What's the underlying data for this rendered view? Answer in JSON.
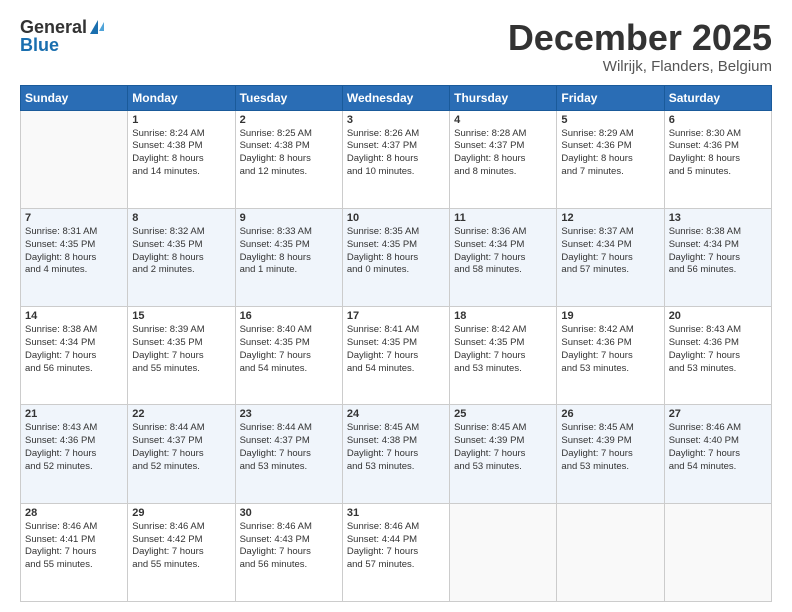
{
  "logo": {
    "general": "General",
    "blue": "Blue"
  },
  "title": {
    "month": "December 2025",
    "location": "Wilrijk, Flanders, Belgium"
  },
  "weekdays": [
    "Sunday",
    "Monday",
    "Tuesday",
    "Wednesday",
    "Thursday",
    "Friday",
    "Saturday"
  ],
  "weeks": [
    [
      {
        "day": "",
        "info": ""
      },
      {
        "day": "1",
        "info": "Sunrise: 8:24 AM\nSunset: 4:38 PM\nDaylight: 8 hours\nand 14 minutes."
      },
      {
        "day": "2",
        "info": "Sunrise: 8:25 AM\nSunset: 4:38 PM\nDaylight: 8 hours\nand 12 minutes."
      },
      {
        "day": "3",
        "info": "Sunrise: 8:26 AM\nSunset: 4:37 PM\nDaylight: 8 hours\nand 10 minutes."
      },
      {
        "day": "4",
        "info": "Sunrise: 8:28 AM\nSunset: 4:37 PM\nDaylight: 8 hours\nand 8 minutes."
      },
      {
        "day": "5",
        "info": "Sunrise: 8:29 AM\nSunset: 4:36 PM\nDaylight: 8 hours\nand 7 minutes."
      },
      {
        "day": "6",
        "info": "Sunrise: 8:30 AM\nSunset: 4:36 PM\nDaylight: 8 hours\nand 5 minutes."
      }
    ],
    [
      {
        "day": "7",
        "info": "Sunrise: 8:31 AM\nSunset: 4:35 PM\nDaylight: 8 hours\nand 4 minutes."
      },
      {
        "day": "8",
        "info": "Sunrise: 8:32 AM\nSunset: 4:35 PM\nDaylight: 8 hours\nand 2 minutes."
      },
      {
        "day": "9",
        "info": "Sunrise: 8:33 AM\nSunset: 4:35 PM\nDaylight: 8 hours\nand 1 minute."
      },
      {
        "day": "10",
        "info": "Sunrise: 8:35 AM\nSunset: 4:35 PM\nDaylight: 8 hours\nand 0 minutes."
      },
      {
        "day": "11",
        "info": "Sunrise: 8:36 AM\nSunset: 4:34 PM\nDaylight: 7 hours\nand 58 minutes."
      },
      {
        "day": "12",
        "info": "Sunrise: 8:37 AM\nSunset: 4:34 PM\nDaylight: 7 hours\nand 57 minutes."
      },
      {
        "day": "13",
        "info": "Sunrise: 8:38 AM\nSunset: 4:34 PM\nDaylight: 7 hours\nand 56 minutes."
      }
    ],
    [
      {
        "day": "14",
        "info": "Sunrise: 8:38 AM\nSunset: 4:34 PM\nDaylight: 7 hours\nand 56 minutes."
      },
      {
        "day": "15",
        "info": "Sunrise: 8:39 AM\nSunset: 4:35 PM\nDaylight: 7 hours\nand 55 minutes."
      },
      {
        "day": "16",
        "info": "Sunrise: 8:40 AM\nSunset: 4:35 PM\nDaylight: 7 hours\nand 54 minutes."
      },
      {
        "day": "17",
        "info": "Sunrise: 8:41 AM\nSunset: 4:35 PM\nDaylight: 7 hours\nand 54 minutes."
      },
      {
        "day": "18",
        "info": "Sunrise: 8:42 AM\nSunset: 4:35 PM\nDaylight: 7 hours\nand 53 minutes."
      },
      {
        "day": "19",
        "info": "Sunrise: 8:42 AM\nSunset: 4:36 PM\nDaylight: 7 hours\nand 53 minutes."
      },
      {
        "day": "20",
        "info": "Sunrise: 8:43 AM\nSunset: 4:36 PM\nDaylight: 7 hours\nand 53 minutes."
      }
    ],
    [
      {
        "day": "21",
        "info": "Sunrise: 8:43 AM\nSunset: 4:36 PM\nDaylight: 7 hours\nand 52 minutes."
      },
      {
        "day": "22",
        "info": "Sunrise: 8:44 AM\nSunset: 4:37 PM\nDaylight: 7 hours\nand 52 minutes."
      },
      {
        "day": "23",
        "info": "Sunrise: 8:44 AM\nSunset: 4:37 PM\nDaylight: 7 hours\nand 53 minutes."
      },
      {
        "day": "24",
        "info": "Sunrise: 8:45 AM\nSunset: 4:38 PM\nDaylight: 7 hours\nand 53 minutes."
      },
      {
        "day": "25",
        "info": "Sunrise: 8:45 AM\nSunset: 4:39 PM\nDaylight: 7 hours\nand 53 minutes."
      },
      {
        "day": "26",
        "info": "Sunrise: 8:45 AM\nSunset: 4:39 PM\nDaylight: 7 hours\nand 53 minutes."
      },
      {
        "day": "27",
        "info": "Sunrise: 8:46 AM\nSunset: 4:40 PM\nDaylight: 7 hours\nand 54 minutes."
      }
    ],
    [
      {
        "day": "28",
        "info": "Sunrise: 8:46 AM\nSunset: 4:41 PM\nDaylight: 7 hours\nand 55 minutes."
      },
      {
        "day": "29",
        "info": "Sunrise: 8:46 AM\nSunset: 4:42 PM\nDaylight: 7 hours\nand 55 minutes."
      },
      {
        "day": "30",
        "info": "Sunrise: 8:46 AM\nSunset: 4:43 PM\nDaylight: 7 hours\nand 56 minutes."
      },
      {
        "day": "31",
        "info": "Sunrise: 8:46 AM\nSunset: 4:44 PM\nDaylight: 7 hours\nand 57 minutes."
      },
      {
        "day": "",
        "info": ""
      },
      {
        "day": "",
        "info": ""
      },
      {
        "day": "",
        "info": ""
      }
    ]
  ]
}
